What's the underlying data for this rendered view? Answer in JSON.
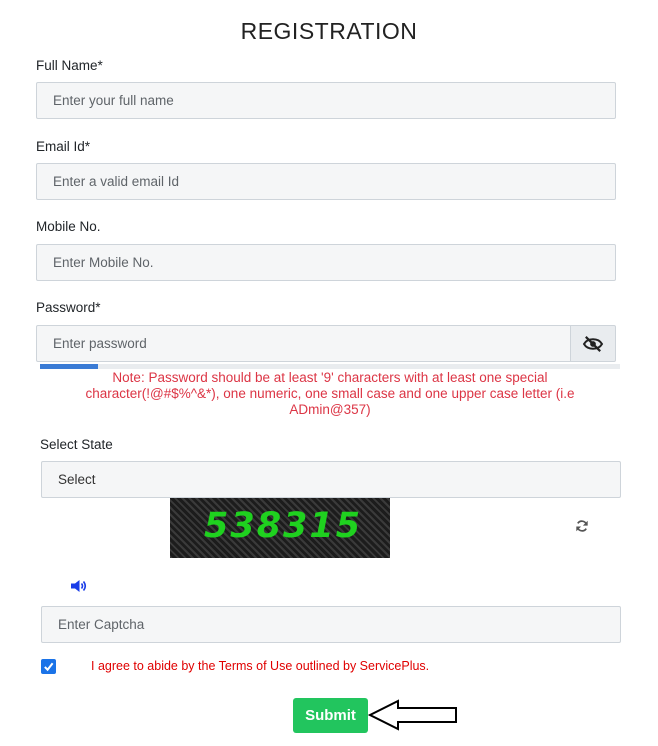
{
  "page": {
    "title": "REGISTRATION"
  },
  "form": {
    "full_name": {
      "label": "Full Name",
      "required_mark": "*",
      "placeholder": "Enter your full name",
      "value": ""
    },
    "email": {
      "label": "Email Id",
      "required_mark": "*",
      "placeholder": "Enter a valid email Id",
      "value": ""
    },
    "mobile": {
      "label": "Mobile No.",
      "placeholder": "Enter Mobile No.",
      "value": ""
    },
    "password": {
      "label": "Password",
      "required_mark": "*",
      "placeholder": "Enter password",
      "value": "",
      "toggle_icon": "eye-slash-icon",
      "strength_fraction": 0.1,
      "note": "Note: Password should be at least '9' characters with at least one special character(!@#$%^&*), one numeric, one small case and one upper case letter (i.e ADmin@357)"
    },
    "state": {
      "label": "Select State",
      "selected": "Select"
    },
    "captcha": {
      "image_text": "538315",
      "refresh_icon": "refresh-icon",
      "audio_icon": "speaker-icon",
      "placeholder": "Enter Captcha",
      "value": ""
    },
    "terms": {
      "checked": true,
      "text": "I agree to abide by the Terms of Use outlined by ServicePlus."
    },
    "submit_label": "Submit"
  },
  "colors": {
    "note_red": "#dc3545",
    "submit_green": "#22c55e",
    "checkbox_blue": "#1a73e8",
    "captcha_green": "#1fd11f"
  }
}
